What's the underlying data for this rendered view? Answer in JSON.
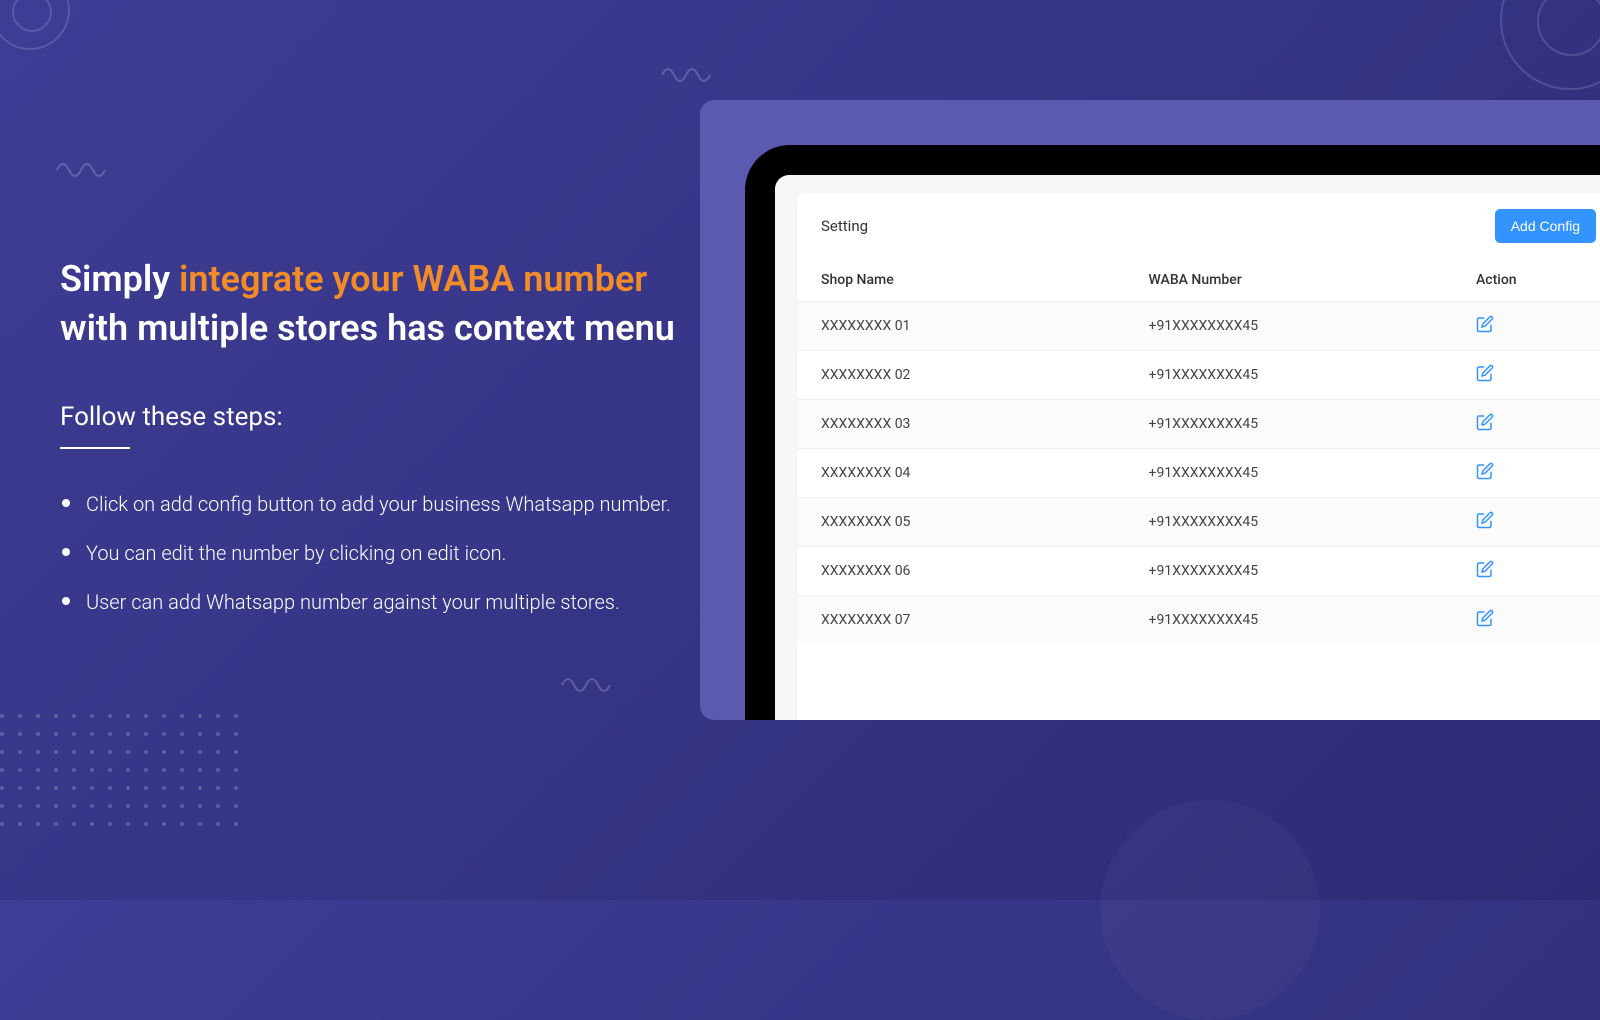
{
  "headline": {
    "prefix": "Simply ",
    "highlight": "integrate your WABA number",
    "suffix": " with multiple stores has context menu"
  },
  "subhead": "Follow these steps:",
  "steps": [
    "Click on add config button to add your business Whatsapp number.",
    "You can edit the number by clicking on edit icon.",
    "User can add Whatsapp number against your multiple stores."
  ],
  "panel": {
    "title": "Setting",
    "add_button": "Add Config",
    "columns": {
      "shop": "Shop Name",
      "waba": "WABA Number",
      "action": "Action"
    },
    "rows": [
      {
        "shop": "XXXXXXXX 01",
        "waba": "+91XXXXXXXX45"
      },
      {
        "shop": "XXXXXXXX 02",
        "waba": "+91XXXXXXXX45"
      },
      {
        "shop": "XXXXXXXX 03",
        "waba": "+91XXXXXXXX45"
      },
      {
        "shop": "XXXXXXXX 04",
        "waba": "+91XXXXXXXX45"
      },
      {
        "shop": "XXXXXXXX 05",
        "waba": "+91XXXXXXXX45"
      },
      {
        "shop": "XXXXXXXX 06",
        "waba": "+91XXXXXXXX45"
      },
      {
        "shop": "XXXXXXXX 07",
        "waba": "+91XXXXXXXX45"
      }
    ]
  }
}
